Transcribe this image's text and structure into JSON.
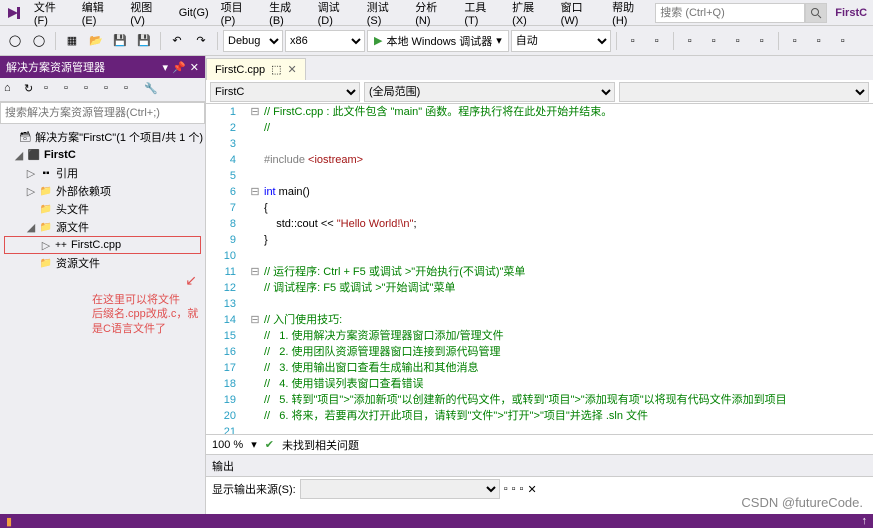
{
  "menubar": {
    "items": [
      "文件(F)",
      "编辑(E)",
      "视图(V)",
      "Git(G)",
      "项目(P)",
      "生成(B)",
      "调试(D)",
      "测试(S)",
      "分析(N)",
      "工具(T)",
      "扩展(X)",
      "窗口(W)",
      "帮助(H)"
    ],
    "search_placeholder": "搜索 (Ctrl+Q)",
    "appname": "FirstC"
  },
  "toolbar": {
    "config": "Debug",
    "platform": "x86",
    "run_label": "本地 Windows 调试器",
    "auto": "自动"
  },
  "sidebar": {
    "title": "解决方案资源管理器",
    "search_placeholder": "搜索解决方案资源管理器(Ctrl+;)",
    "solution": "解决方案\"FirstC\"(1 个项目/共 1 个)",
    "project": "FirstC",
    "nodes": {
      "refs": "引用",
      "ext": "外部依赖项",
      "headers": "头文件",
      "sources": "源文件",
      "file": "FirstC.cpp",
      "resources": "资源文件"
    },
    "annotation_l1": "在这里可以将文件",
    "annotation_l2": "后缀名.cpp改成.c，就",
    "annotation_l3": "是C语言文件了"
  },
  "editor": {
    "tab": "FirstC.cpp",
    "nav_left": "FirstC",
    "nav_right": "(全局范围)",
    "lines": [
      {
        "n": 1,
        "g": "⊟",
        "html": "<span class='c-comment'>// FirstC.cpp : 此文件包含 \"main\" 函数。程序执行将在此处开始并结束。</span>"
      },
      {
        "n": 2,
        "g": "",
        "html": "<span class='c-comment'>//</span>"
      },
      {
        "n": 3,
        "g": "",
        "html": ""
      },
      {
        "n": 4,
        "g": "",
        "html": "<span class='c-prep'>#include </span><span class='c-inc'>&lt;iostream&gt;</span>"
      },
      {
        "n": 5,
        "g": "",
        "html": ""
      },
      {
        "n": 6,
        "g": "⊟",
        "html": "<span class='c-kw'>int</span> main()"
      },
      {
        "n": 7,
        "g": "",
        "html": "{"
      },
      {
        "n": 8,
        "g": "",
        "html": "    std::cout &lt;&lt; <span class='c-str'>\"Hello World!\\n\"</span>;"
      },
      {
        "n": 9,
        "g": "",
        "html": "}"
      },
      {
        "n": 10,
        "g": "",
        "html": ""
      },
      {
        "n": 11,
        "g": "⊟",
        "html": "<span class='c-comment'>// 运行程序: Ctrl + F5 或调试 &gt;\"开始执行(不调试)\"菜单</span>"
      },
      {
        "n": 12,
        "g": "",
        "html": "<span class='c-comment'>// 调试程序: F5 或调试 &gt;\"开始调试\"菜单</span>"
      },
      {
        "n": 13,
        "g": "",
        "html": ""
      },
      {
        "n": 14,
        "g": "⊟",
        "html": "<span class='c-comment'>// 入门使用技巧:</span>"
      },
      {
        "n": 15,
        "g": "",
        "html": "<span class='c-comment'>//   1. 使用解决方案资源管理器窗口添加/管理文件</span>"
      },
      {
        "n": 16,
        "g": "",
        "html": "<span class='c-comment'>//   2. 使用团队资源管理器窗口连接到源代码管理</span>"
      },
      {
        "n": 17,
        "g": "",
        "html": "<span class='c-comment'>//   3. 使用输出窗口查看生成输出和其他消息</span>"
      },
      {
        "n": 18,
        "g": "",
        "html": "<span class='c-comment'>//   4. 使用错误列表窗口查看错误</span>"
      },
      {
        "n": 19,
        "g": "",
        "html": "<span class='c-comment'>//   5. 转到\"项目\"&gt;\"添加新项\"以创建新的代码文件，或转到\"项目\"&gt;\"添加现有项\"以将现有代码文件添加到项目</span>"
      },
      {
        "n": 20,
        "g": "",
        "html": "<span class='c-comment'>//   6. 将来，若要再次打开此项目，请转到\"文件\"&gt;\"打开\"&gt;\"项目\"并选择 .sln 文件</span>"
      },
      {
        "n": 21,
        "g": "",
        "html": ""
      }
    ],
    "zoom": "100 %",
    "status": "未找到相关问题"
  },
  "output": {
    "title": "输出",
    "source_label": "显示输出来源(S):"
  },
  "statusbar": {
    "ln": "",
    "col": ""
  },
  "watermark": "CSDN @futureCode."
}
